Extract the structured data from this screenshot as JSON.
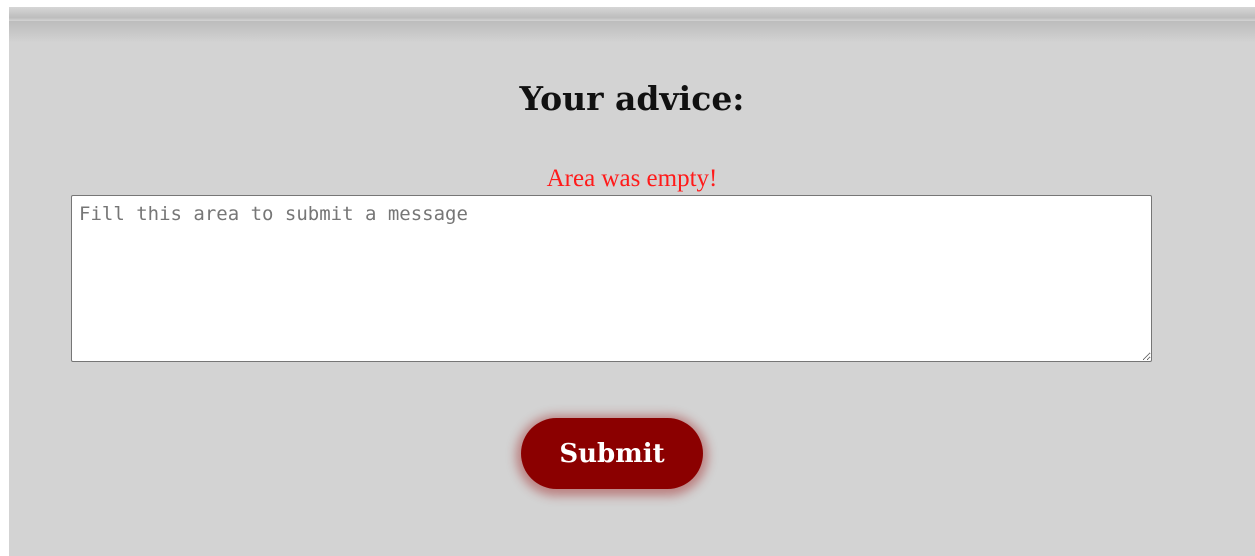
{
  "form": {
    "title": "Your advice:",
    "error_message": "Area was empty!",
    "message_field": {
      "value": "",
      "placeholder": "Fill this area to submit a message"
    },
    "submit_label": "Submit"
  },
  "colors": {
    "background": "#d3d3d3",
    "error_text": "#ff1a1a",
    "submit_button": "#8b0000"
  }
}
